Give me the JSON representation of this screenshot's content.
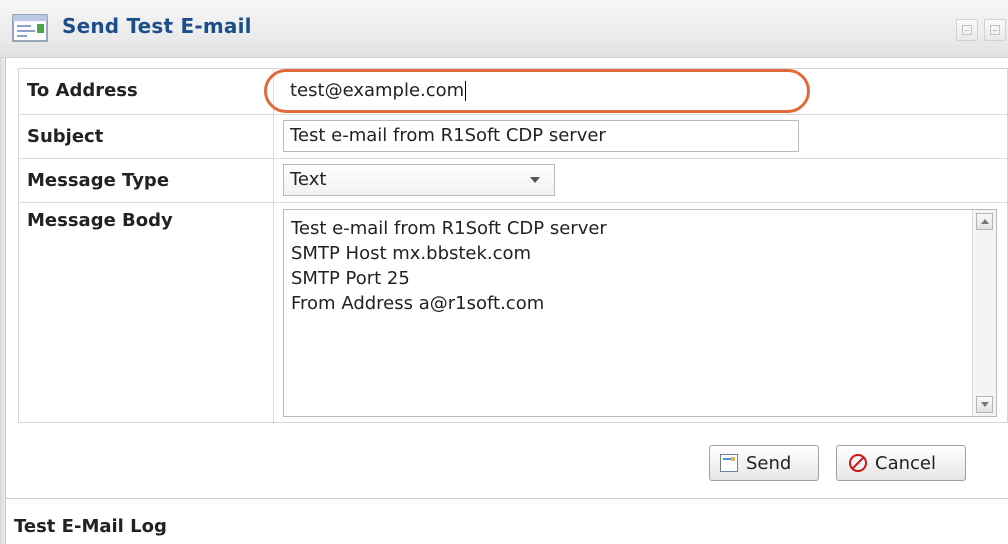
{
  "window": {
    "title": "Send Test E-mail"
  },
  "form": {
    "to_address": {
      "label": "To Address",
      "value": "test@example.com"
    },
    "subject": {
      "label": "Subject",
      "value": "Test e-mail from R1Soft CDP server"
    },
    "message_type": {
      "label": "Message Type",
      "selected": "Text"
    },
    "message_body": {
      "label": "Message Body",
      "lines": [
        "Test e-mail from R1Soft CDP server",
        "SMTP Host mx.bbstek.com",
        "SMTP Port 25",
        "From Address a@r1soft.com"
      ]
    }
  },
  "actions": {
    "send_label": "Send",
    "cancel_label": "Cancel"
  },
  "log": {
    "title": "Test E-Mail Log"
  },
  "colors": {
    "title_text": "#1d4e8c",
    "highlight": "#e26a3a",
    "cancel_icon": "#d01515"
  },
  "icons": {
    "title": "email-window-icon",
    "send": "send-icon",
    "cancel": "cancel-icon",
    "minimize": "minimize-icon",
    "close": "close-icon"
  }
}
